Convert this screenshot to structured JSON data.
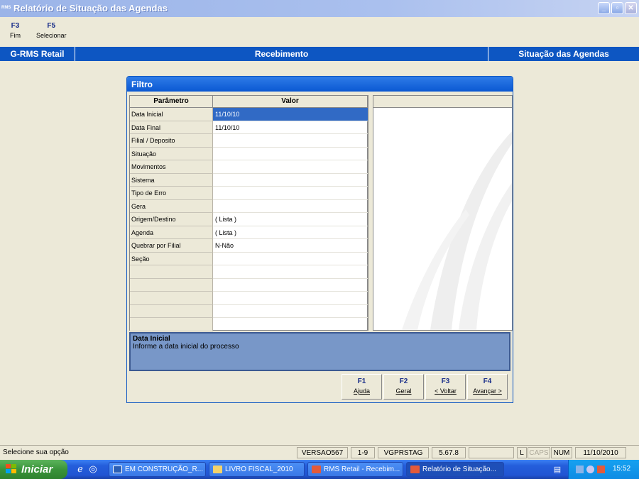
{
  "window": {
    "app_icon_text": "RMS",
    "title": "Relatório de Situação das Agendas",
    "btn_min": "_",
    "btn_max": "▫",
    "btn_close": "✕"
  },
  "toolbar": [
    {
      "key": "F3",
      "label": "Fim"
    },
    {
      "key": "F5",
      "label": "Selecionar"
    }
  ],
  "header_strip": {
    "left": "G-RMS Retail",
    "center": "Recebimento",
    "right": "Situação das Agendas"
  },
  "filter_dialog": {
    "title": "Filtro",
    "columns": [
      "Parâmetro",
      "Valor"
    ],
    "rows": [
      {
        "param": "Data Inicial",
        "value": "11/10/10",
        "selected": true
      },
      {
        "param": "Data Final",
        "value": "11/10/10"
      },
      {
        "param": "Filial / Deposito",
        "value": ""
      },
      {
        "param": "Situação",
        "value": ""
      },
      {
        "param": "Movimentos",
        "value": ""
      },
      {
        "param": "Sistema",
        "value": ""
      },
      {
        "param": "Tipo de Erro",
        "value": ""
      },
      {
        "param": "Gera",
        "value": ""
      },
      {
        "param": "Origem/Destino",
        "value": "( Lista )"
      },
      {
        "param": "Agenda",
        "value": "( Lista )"
      },
      {
        "param": "Quebrar por Filial",
        "value": "N-Não"
      },
      {
        "param": "Seção",
        "value": ""
      },
      {
        "param": "",
        "value": ""
      },
      {
        "param": "",
        "value": ""
      },
      {
        "param": "",
        "value": ""
      },
      {
        "param": "",
        "value": ""
      },
      {
        "param": "",
        "value": ""
      }
    ],
    "help": {
      "title": "Data Inicial",
      "description": "Informe a data inicial do processo"
    },
    "buttons": [
      {
        "key": "F1",
        "label": "Ajuda"
      },
      {
        "key": "F2",
        "label": "Geral"
      },
      {
        "key": "F3",
        "label": "< Voltar"
      },
      {
        "key": "F4",
        "label": "Avançar >"
      }
    ]
  },
  "status_bar": {
    "message": "Selecione sua opção",
    "cells": [
      "VERSAO567",
      "1-9",
      "VGPRSTAG",
      "5.67.8",
      "",
      "L",
      "CAPS",
      "NUM",
      "11/10/2010"
    ]
  },
  "taskbar": {
    "start_label": "Iniciar",
    "tasks": [
      {
        "label": "EM CONSTRUÇÃO_R...",
        "icon": "word-doc-icon"
      },
      {
        "label": "LIVRO FISCAL_2010",
        "icon": "folder-icon"
      },
      {
        "label": "RMS Retail - Recebim...",
        "icon": "rms-app-icon"
      },
      {
        "label": "Relatório de Situação...",
        "icon": "rms-app-icon"
      }
    ],
    "clock": "15:52"
  },
  "colors": {
    "accent": "#0d56c2",
    "selected_row": "#316ac5",
    "help_bg": "#7897c8",
    "fkey_text": "#1a2f8a"
  }
}
